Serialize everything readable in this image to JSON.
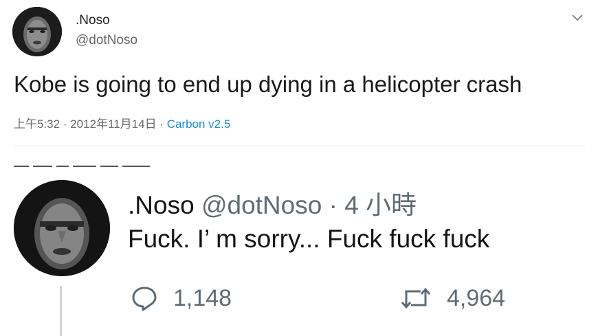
{
  "tweet1": {
    "display_name": ".Noso",
    "handle": "@dotNoso",
    "text": "Kobe is going to end up dying in a helicopter crash",
    "timestamp": "上午5:32 · 2012年11月14日",
    "separator": " · ",
    "source": "Carbon v2.5",
    "menu_icon": "chevron-down-icon"
  },
  "tweet2": {
    "display_name": ".Noso",
    "handle_time": "@dotNoso · 4 小時",
    "text": "Fuck. I’  m sorry... Fuck fuck fuck",
    "reply_count": "1,148",
    "retweet_count": "4,964",
    "reply_icon": "reply-icon",
    "retweet_icon": "retweet-icon"
  },
  "colors": {
    "link": "#1b8bd6",
    "muted": "#6b6b6b",
    "divider": "#e3e3e3"
  }
}
